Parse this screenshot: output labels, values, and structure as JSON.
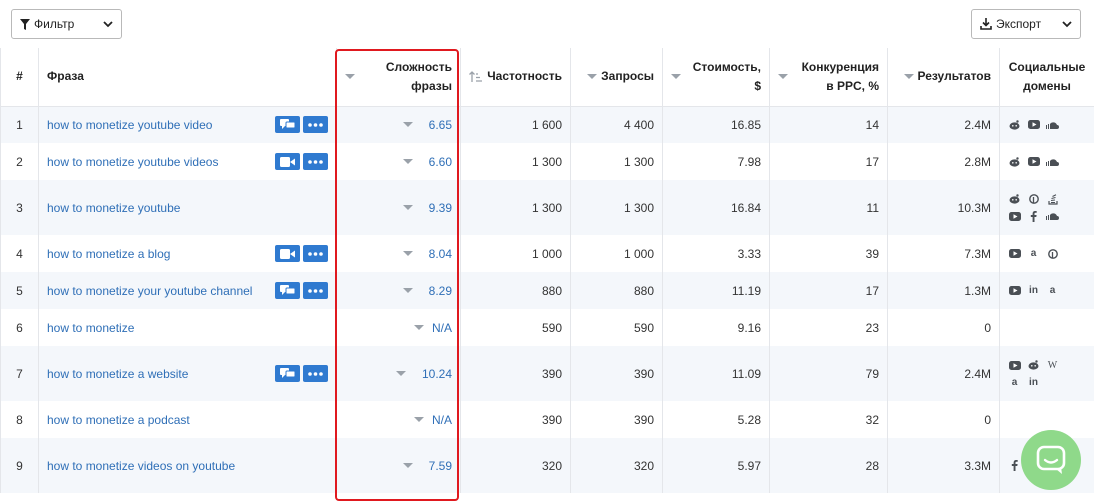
{
  "toolbar": {
    "filter_label": "Фильтр",
    "export_label": "Экспорт"
  },
  "table": {
    "headers": {
      "index": "#",
      "phrase": "Фраза",
      "difficulty_line1": "Сложность",
      "difficulty_line2": "фразы",
      "frequency": "Частотность",
      "queries": "Запросы",
      "cost_line1": "Стоимость,",
      "cost_line2": "$",
      "competition_line1": "Конкуренция",
      "competition_line2": "в PPC, %",
      "results": "Результатов",
      "social_line1": "Социальные",
      "social_line2": "домены"
    },
    "rows": [
      {
        "index": "1",
        "phrase": "how to monetize youtube video",
        "difficulty": "6.65",
        "frequency": "1 600",
        "queries": "4 400",
        "cost": "16.85",
        "competition": "14",
        "results": "2.4M"
      },
      {
        "index": "2",
        "phrase": "how to monetize youtube videos",
        "difficulty": "6.60",
        "frequency": "1 300",
        "queries": "1 300",
        "cost": "7.98",
        "competition": "17",
        "results": "2.8M"
      },
      {
        "index": "3",
        "phrase": "how to monetize youtube",
        "difficulty": "9.39",
        "frequency": "1 300",
        "queries": "1 300",
        "cost": "16.84",
        "competition": "11",
        "results": "10.3M"
      },
      {
        "index": "4",
        "phrase": "how to monetize a blog",
        "difficulty": "8.04",
        "frequency": "1 000",
        "queries": "1 000",
        "cost": "3.33",
        "competition": "39",
        "results": "7.3M"
      },
      {
        "index": "5",
        "phrase": "how to monetize your youtube channel",
        "difficulty": "8.29",
        "frequency": "880",
        "queries": "880",
        "cost": "11.19",
        "competition": "17",
        "results": "1.3M"
      },
      {
        "index": "6",
        "phrase": "how to monetize",
        "difficulty": "N/A",
        "frequency": "590",
        "queries": "590",
        "cost": "9.16",
        "competition": "23",
        "results": "0"
      },
      {
        "index": "7",
        "phrase": "how to monetize a website",
        "difficulty": "10.24",
        "frequency": "390",
        "queries": "390",
        "cost": "11.09",
        "competition": "79",
        "results": "2.4M"
      },
      {
        "index": "8",
        "phrase": "how to monetize a podcast",
        "difficulty": "N/A",
        "frequency": "390",
        "queries": "390",
        "cost": "5.28",
        "competition": "32",
        "results": "0"
      },
      {
        "index": "9",
        "phrase": "how to monetize videos on youtube",
        "difficulty": "7.59",
        "frequency": "320",
        "queries": "320",
        "cost": "5.97",
        "competition": "28",
        "results": "3.3M"
      }
    ]
  },
  "colors": {
    "accent_blue": "#2f7ad0",
    "link_blue": "#2f6fb7",
    "highlight_red": "#e0191f",
    "chat_green": "#8fd98a"
  }
}
